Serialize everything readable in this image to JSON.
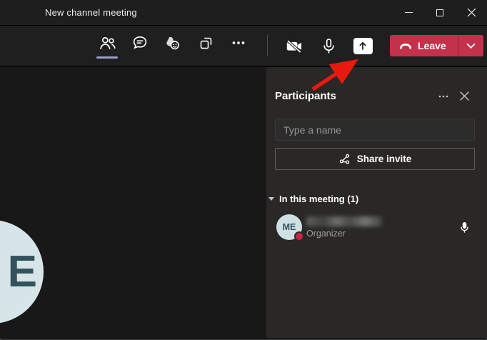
{
  "window": {
    "title": "New channel meeting"
  },
  "titlebar": {
    "controls": [
      {
        "id": "minimize"
      },
      {
        "id": "maximize"
      },
      {
        "id": "close"
      }
    ]
  },
  "toolbar": {
    "tabs": [
      {
        "id": "participants",
        "icon": "people-icon",
        "active": true
      },
      {
        "id": "chat",
        "icon": "chat-icon",
        "active": false
      },
      {
        "id": "reactions",
        "icon": "reactions-icon",
        "active": false
      },
      {
        "id": "breakout-rooms",
        "icon": "breakout-rooms-icon",
        "active": false
      },
      {
        "id": "more",
        "icon": "ellipsis-icon",
        "active": false
      }
    ],
    "device_controls": [
      {
        "id": "camera",
        "icon": "camera-off-icon",
        "state": "off"
      },
      {
        "id": "microphone",
        "icon": "microphone-icon",
        "state": "on"
      },
      {
        "id": "share-screen",
        "icon": "share-screen-icon",
        "state": "highlighted"
      }
    ],
    "leave_button": {
      "label": "Leave",
      "color": "#c4314b"
    }
  },
  "annotation": {
    "type": "red-arrow",
    "color": "#e8190e",
    "points_to": "share-screen-button"
  },
  "stage": {
    "avatar": {
      "visible_letter": "E",
      "bg": "#d7e5e9",
      "fg": "#33525b"
    }
  },
  "panel": {
    "title": "Participants",
    "search": {
      "placeholder": "Type a name"
    },
    "share_invite": {
      "label": "Share invite"
    },
    "section": {
      "label": "In this meeting (1)"
    },
    "participants": [
      {
        "initials": "ME",
        "name_redacted": true,
        "role": "Organizer",
        "status": "busy",
        "mic": "on"
      }
    ]
  },
  "colors": {
    "titlebar_bg": "#1f1e1e",
    "toolbar_bg": "#201f1f",
    "stage_bg": "#181818",
    "panel_bg": "#292827",
    "accent_underline": "#9a9cc9",
    "leave_red": "#c4314b",
    "status_busy": "#c22a44",
    "arrow_red": "#e8190e"
  }
}
